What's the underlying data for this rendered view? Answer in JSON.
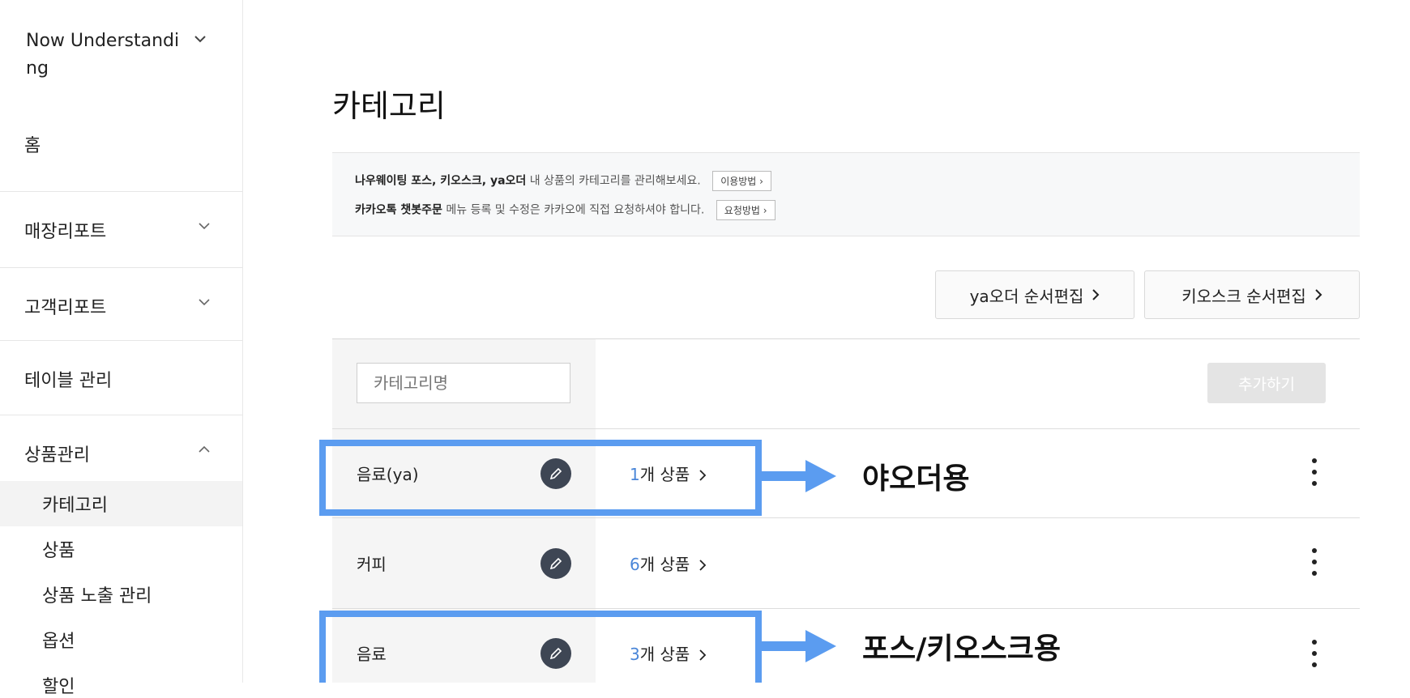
{
  "sidebar": {
    "store_name": "Now Understanding",
    "home": "홈",
    "menu": [
      {
        "label": "매장리포트"
      },
      {
        "label": "고객리포트"
      },
      {
        "label": "테이블 관리"
      },
      {
        "label": "상품관리"
      }
    ],
    "submenu": [
      "카테고리",
      "상품",
      "상품 노출 관리",
      "옵션",
      "할인"
    ]
  },
  "page": {
    "title": "카테고리",
    "info_line1_bold": "나우웨이팅 포스, 키오스크, ya오더",
    "info_line1_rest": " 내 상품의 카테고리를 관리해보세요.",
    "info_line1_btn": "이용방법",
    "info_line2_bold": "카카오톡 챗봇주문",
    "info_line2_rest": " 메뉴 등록 및 수정은 카카오에 직접 요청하셔야 합니다.",
    "info_line2_btn": "요청방법",
    "ya_order_btn": "ya오더 순서편집",
    "kiosk_order_btn": "키오스크 순서편집",
    "input_placeholder": "카테고리명",
    "add_btn": "추가하기"
  },
  "categories": [
    {
      "name": "음료(ya)",
      "count": "1",
      "count_suffix": "개 상품"
    },
    {
      "name": "커피",
      "count": "6",
      "count_suffix": "개 상품"
    },
    {
      "name": "음료",
      "count": "3",
      "count_suffix": "개 상품"
    }
  ],
  "annotations": {
    "note1": "야오더용",
    "note2": "포스/키오스크용",
    "color": "#5b9cf0"
  },
  "icons": [
    "chevron-down-icon",
    "chevron-up-icon",
    "chevron-right-icon",
    "pencil-icon",
    "more-vertical-icon",
    "arrow-right-icon"
  ]
}
